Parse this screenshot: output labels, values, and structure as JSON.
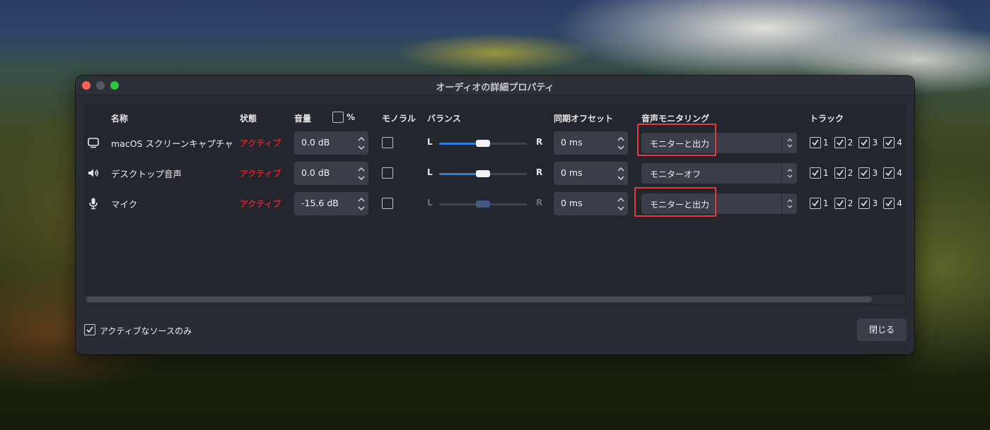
{
  "window": {
    "title": "オーディオの詳細プロパティ"
  },
  "headers": {
    "name": "名称",
    "status": "状態",
    "volume": "音量",
    "percent": "%",
    "mono": "モノラル",
    "balance": "バランス",
    "sync_offset": "同期オフセット",
    "monitoring": "音声モニタリング",
    "tracks": "トラック"
  },
  "rows": [
    {
      "icon": "display-icon",
      "name": "macOS スクリーンキャプチャ",
      "status": "アクティブ",
      "volume": "0.0 dB",
      "mono": false,
      "balance_left": "L",
      "balance_right": "R",
      "balance_level": 0.5,
      "balance_enabled": true,
      "sync_offset": "0 ms",
      "monitoring": "モニターと出力",
      "highlighted": true,
      "tracks": [
        "1",
        "2",
        "3",
        "4"
      ]
    },
    {
      "icon": "speaker-icon",
      "name": "デスクトップ音声",
      "status": "アクティブ",
      "volume": "0.0 dB",
      "mono": false,
      "balance_left": "L",
      "balance_right": "R",
      "balance_level": 0.5,
      "balance_enabled": true,
      "sync_offset": "0 ms",
      "monitoring": "モニターオフ",
      "highlighted": false,
      "tracks": [
        "1",
        "2",
        "3",
        "4"
      ]
    },
    {
      "icon": "microphone-icon",
      "name": "マイク",
      "status": "アクティブ",
      "volume": "-15.6 dB",
      "mono": false,
      "balance_left": "L",
      "balance_right": "R",
      "balance_level": 0.5,
      "balance_enabled": false,
      "sync_offset": "0 ms",
      "monitoring": "モニターと出力",
      "highlighted": true,
      "tracks": [
        "1",
        "2",
        "3",
        "4"
      ]
    }
  ],
  "footer": {
    "active_only_label": "アクティブなソースのみ",
    "active_only_checked": true,
    "close_label": "閉じる"
  },
  "colors": {
    "status_active": "#d8202b",
    "accent": "#2b7de0",
    "highlight": "#e23a3f"
  }
}
